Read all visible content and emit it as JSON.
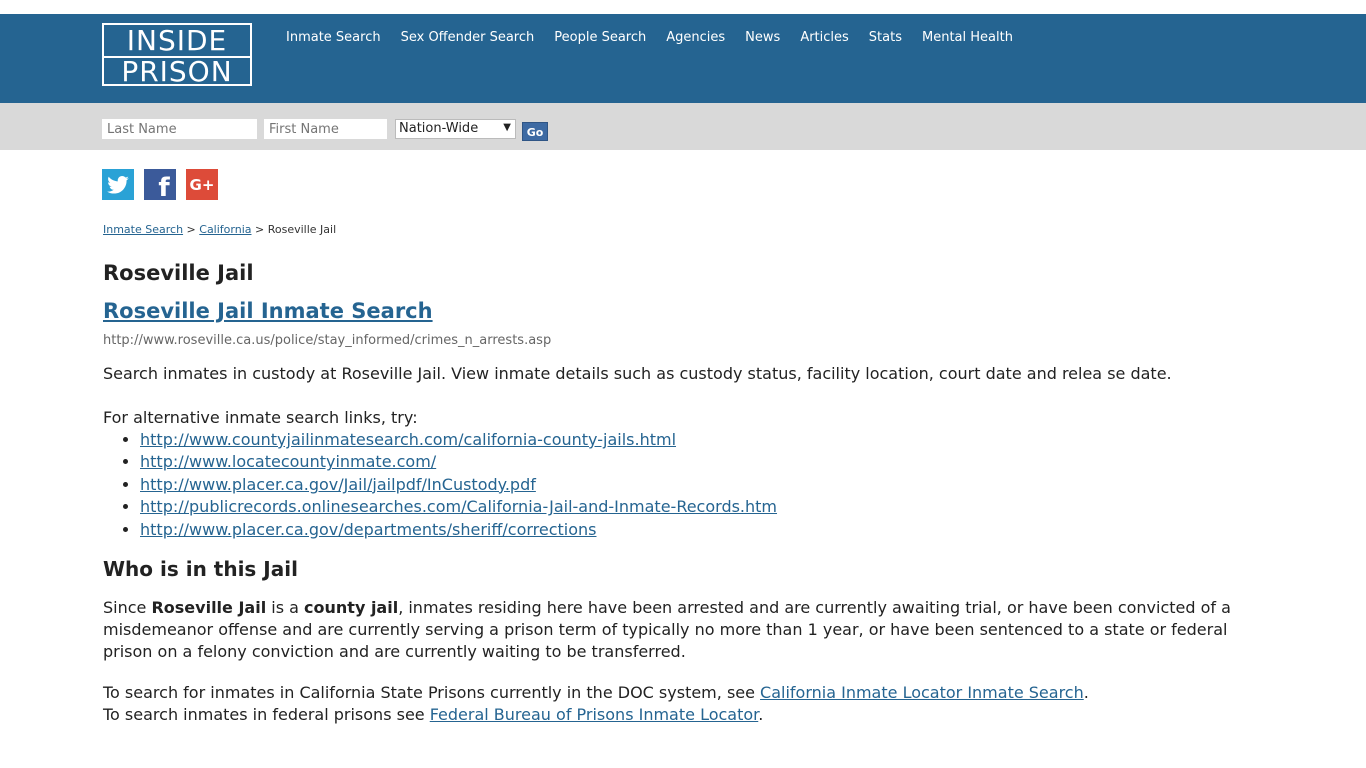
{
  "logo": {
    "line1": "INSIDE",
    "line2": "PRISON"
  },
  "nav": [
    "Inmate Search",
    "Sex Offender Search",
    "People Search",
    "Agencies",
    "News",
    "Articles",
    "Stats",
    "Mental Health"
  ],
  "search": {
    "last_placeholder": "Last Name",
    "first_placeholder": "First Name",
    "region_selected": "Nation-Wide",
    "go_label": "Go"
  },
  "social": {
    "twitter_glyph": "🐦",
    "facebook_glyph": "f",
    "google_glyph": "G+"
  },
  "breadcrumb": {
    "item1": "Inmate Search",
    "sep": ">",
    "item2": "California",
    "current": "Roseville Jail"
  },
  "page_title": "Roseville Jail",
  "search_link_title": "Roseville Jail Inmate Search",
  "search_url": "http://www.roseville.ca.us/police/stay_informed/crimes_n_arrests.asp",
  "description": "Search inmates in custody at Roseville Jail. View inmate details such as custody status, facility location, court date and relea se date.",
  "alt_intro": "For alternative inmate search links, try:",
  "alt_links": [
    "http://www.countyjailinmatesearch.com/california-county-jails.html",
    "http://www.locatecountyinmate.com/",
    "http://www.placer.ca.gov/Jail/jailpdf/InCustody.pdf",
    "http://publicrecords.onlinesearches.com/California-Jail-and-Inmate-Records.htm",
    "http://www.placer.ca.gov/departments/sheriff/corrections"
  ],
  "who_heading": "Who is in this Jail",
  "who_text": {
    "p1_a": "Since ",
    "p1_b": "Roseville Jail",
    "p1_c": " is a ",
    "p1_d": "county jail",
    "p1_e": ", inmates residing here have been arrested and are currently awaiting trial, or have been convicted of a misdemeanor offense and are currently serving a prison term of typically no more than 1 year, or have been sentenced to a state or federal prison on a felony conviction and are currently waiting to be transferred.",
    "p2_a": "To search for inmates in California State Prisons currently in the DOC system, see ",
    "p2_link1": "California Inmate Locator Inmate Search",
    "p2_b": ".",
    "p2_c": "To search inmates in federal prisons see ",
    "p2_link2": "Federal Bureau of Prisons Inmate Locator",
    "p2_d": "."
  }
}
